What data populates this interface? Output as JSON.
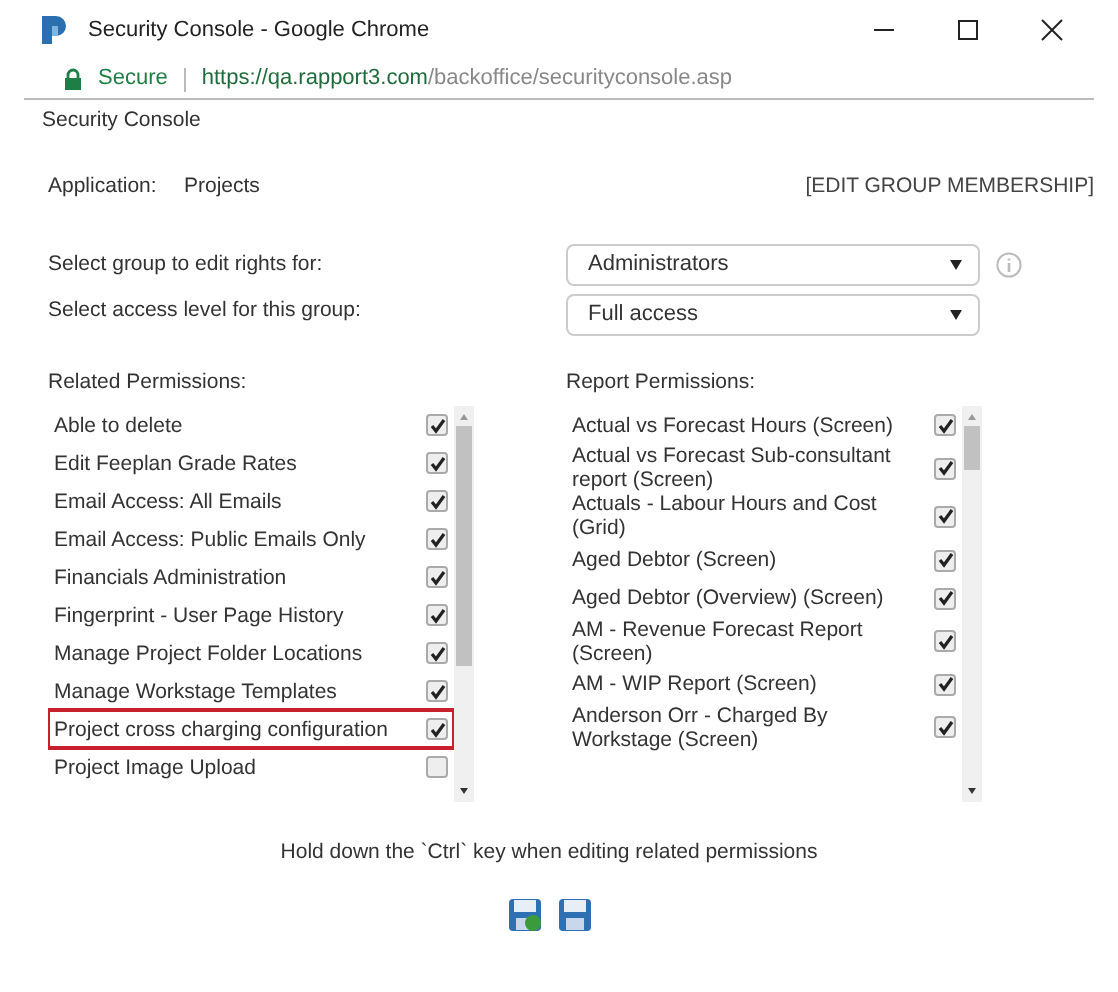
{
  "window": {
    "title": "Security Console - Google Chrome"
  },
  "address_bar": {
    "secure_label": "Secure",
    "url_host": "https://qa.rapport3.com",
    "url_path": "/backoffice/securityconsole.asp"
  },
  "page_title": "Security Console",
  "application": {
    "label": "Application:",
    "value": "Projects"
  },
  "edit_group_link": "[EDIT GROUP MEMBERSHIP]",
  "group_select": {
    "label": "Select group to edit rights for:",
    "value": "Administrators"
  },
  "access_select": {
    "label": "Select access level for this group:",
    "value": "Full access"
  },
  "related_permissions": {
    "heading": "Related Permissions:",
    "items": [
      {
        "label": "Able to delete",
        "checked": true,
        "highlighted": false
      },
      {
        "label": "Edit Feeplan Grade Rates",
        "checked": true,
        "highlighted": false
      },
      {
        "label": "Email Access: All Emails",
        "checked": true,
        "highlighted": false
      },
      {
        "label": "Email Access: Public Emails Only",
        "checked": true,
        "highlighted": false
      },
      {
        "label": "Financials Administration",
        "checked": true,
        "highlighted": false
      },
      {
        "label": "Fingerprint - User Page History",
        "checked": true,
        "highlighted": false
      },
      {
        "label": "Manage Project Folder Locations",
        "checked": true,
        "highlighted": false
      },
      {
        "label": "Manage Workstage Templates",
        "checked": true,
        "highlighted": false
      },
      {
        "label": "Project cross charging configuration",
        "checked": true,
        "highlighted": true
      },
      {
        "label": "Project Image Upload",
        "checked": false,
        "highlighted": false
      }
    ]
  },
  "report_permissions": {
    "heading": "Report Permissions:",
    "items": [
      {
        "label": "Actual vs Forecast Hours (Screen)",
        "checked": true
      },
      {
        "label": "Actual vs Forecast Sub-consultant report (Screen)",
        "checked": true
      },
      {
        "label": "Actuals - Labour Hours and Cost (Grid)",
        "checked": true
      },
      {
        "label": "Aged Debtor (Screen)",
        "checked": true
      },
      {
        "label": "Aged Debtor (Overview) (Screen)",
        "checked": true
      },
      {
        "label": "AM - Revenue Forecast Report (Screen)",
        "checked": true
      },
      {
        "label": "AM - WIP Report (Screen)",
        "checked": true
      },
      {
        "label": "Anderson Orr - Charged By Workstage (Screen)",
        "checked": true
      }
    ]
  },
  "hint": "Hold down the `Ctrl` key when editing related permissions"
}
